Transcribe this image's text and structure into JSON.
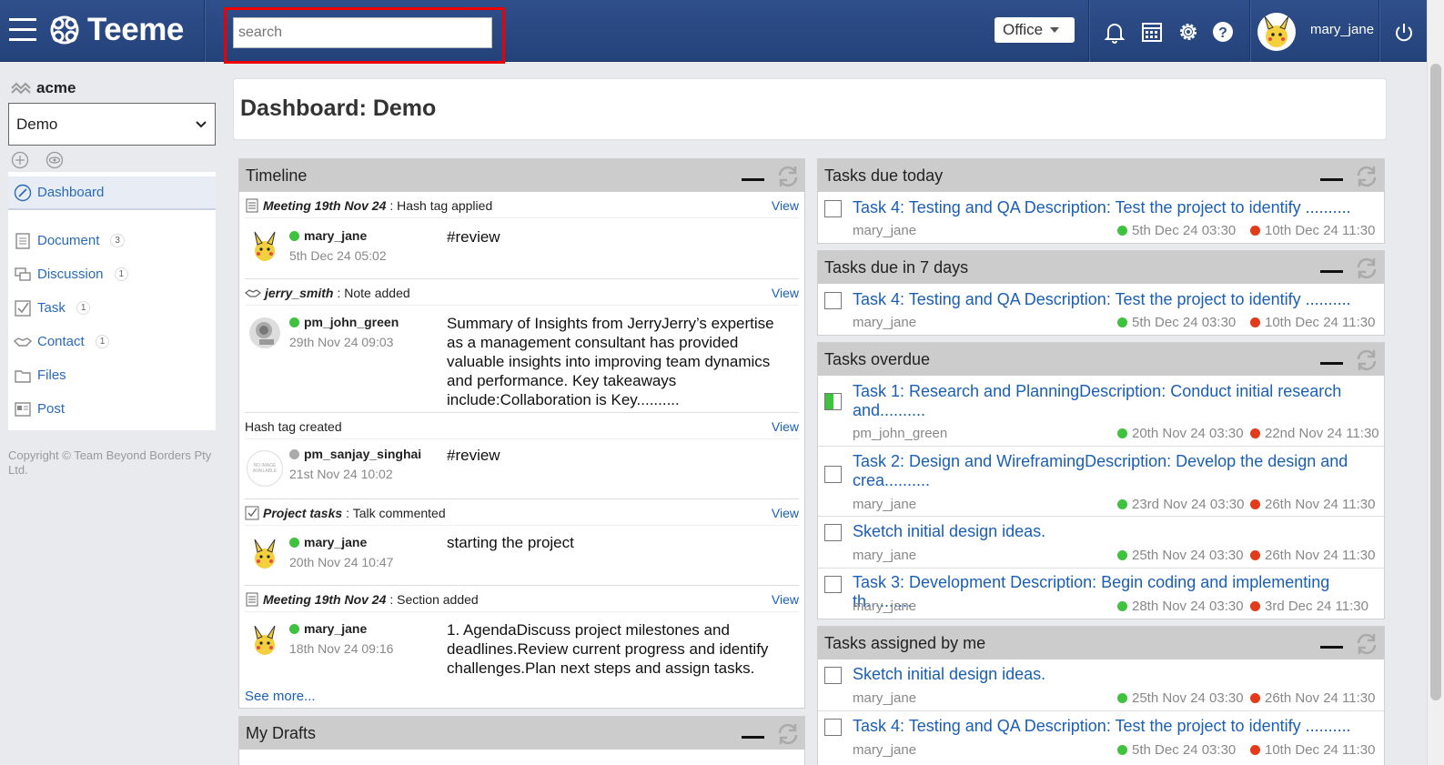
{
  "app": {
    "name": "Teeme"
  },
  "search": {
    "placeholder": "search"
  },
  "header": {
    "office_label": "Office",
    "username": "mary_jane"
  },
  "sidebar": {
    "org": "acme",
    "selected_space": "Demo",
    "items": [
      {
        "label": "Dashboard",
        "count": ""
      },
      {
        "label": "Document",
        "count": "3"
      },
      {
        "label": "Discussion",
        "count": "1"
      },
      {
        "label": "Task",
        "count": "1"
      },
      {
        "label": "Contact",
        "count": "1"
      },
      {
        "label": "Files",
        "count": ""
      },
      {
        "label": "Post",
        "count": ""
      }
    ],
    "copyright": "Copyright © Team Beyond Borders Pty Ltd."
  },
  "main": {
    "title": "Dashboard: Demo"
  },
  "timeline": {
    "title": "Timeline",
    "view_label": "View",
    "see_more": "See more...",
    "items": [
      {
        "source": "Meeting 19th Nov 24",
        "action": ": Hash tag applied",
        "user": "mary_jane",
        "date": "5th Dec 24 05:02",
        "text": "#review",
        "status": "online"
      },
      {
        "source": "jerry_smith",
        "action": ": Note added",
        "user": "pm_john_green",
        "date": "29th Nov 24 09:03",
        "text": "Summary of Insights from JerryJerry’s expertise as a management consultant has provided valuable insights into improving team dynamics and performance. Key takeaways include:Collaboration is Key..........",
        "status": "online"
      },
      {
        "source": "",
        "action": "Hash tag created",
        "user": "pm_sanjay_singhai",
        "date": "21st Nov 24 10:02",
        "text": "#review",
        "status": "offline"
      },
      {
        "source": "Project tasks",
        "action": ": Talk commented",
        "user": "mary_jane",
        "date": "20th Nov 24 10:47",
        "text": "starting the project",
        "status": "online"
      },
      {
        "source": "Meeting 19th Nov 24",
        "action": ": Section added",
        "user": "mary_jane",
        "date": "18th Nov 24 09:16",
        "text": "1. AgendaDiscuss project milestones and deadlines.Review current progress and identify challenges.Plan next steps and assign tasks.",
        "status": "online"
      }
    ]
  },
  "drafts": {
    "title": "My Drafts"
  },
  "no_image_text": "NO IMAGE AVAILABLE",
  "tasks_today": {
    "title": "Tasks due today",
    "tasks": [
      {
        "title": "Task 4: Testing and QA Description: Test the project to identify ..........",
        "user": "mary_jane",
        "start": "5th Dec 24 03:30",
        "end": "10th Dec 24 11:30"
      }
    ]
  },
  "tasks_7days": {
    "title": "Tasks due in 7 days",
    "tasks": [
      {
        "title": "Task 4: Testing and QA Description: Test the project to identify ..........",
        "user": "mary_jane",
        "start": "5th Dec 24 03:30",
        "end": "10th Dec 24 11:30"
      }
    ]
  },
  "tasks_overdue": {
    "title": "Tasks overdue",
    "tasks": [
      {
        "title": "Task 1: Research and PlanningDescription: Conduct initial research and..........",
        "user": "pm_john_green",
        "start": "20th Nov 24 03:30",
        "end": "22nd Nov 24 11:30",
        "progress": 0.5
      },
      {
        "title": "Task 2: Design and WireframingDescription: Develop the design and crea..........",
        "user": "mary_jane",
        "start": "23rd Nov 24 03:30",
        "end": "26th Nov 24 11:30"
      },
      {
        "title": "Sketch initial design ideas.",
        "user": "mary_jane",
        "start": "25th Nov 24 03:30",
        "end": "26th Nov 24 11:30"
      },
      {
        "title": "Task 3: Development Description: Begin coding and implementing th..........",
        "user": "mary_jane",
        "start": "28th Nov 24 03:30",
        "end": "3rd Dec 24 11:30"
      }
    ]
  },
  "tasks_assigned": {
    "title": "Tasks assigned by me",
    "tasks": [
      {
        "title": "Sketch initial design ideas.",
        "user": "mary_jane",
        "start": "25th Nov 24 03:30",
        "end": "26th Nov 24 11:30"
      },
      {
        "title": "Task 4: Testing and QA Description: Test the project to identify ..........",
        "user": "mary_jane",
        "start": "5th Dec 24 03:30",
        "end": "10th Dec 24 11:30"
      }
    ]
  }
}
